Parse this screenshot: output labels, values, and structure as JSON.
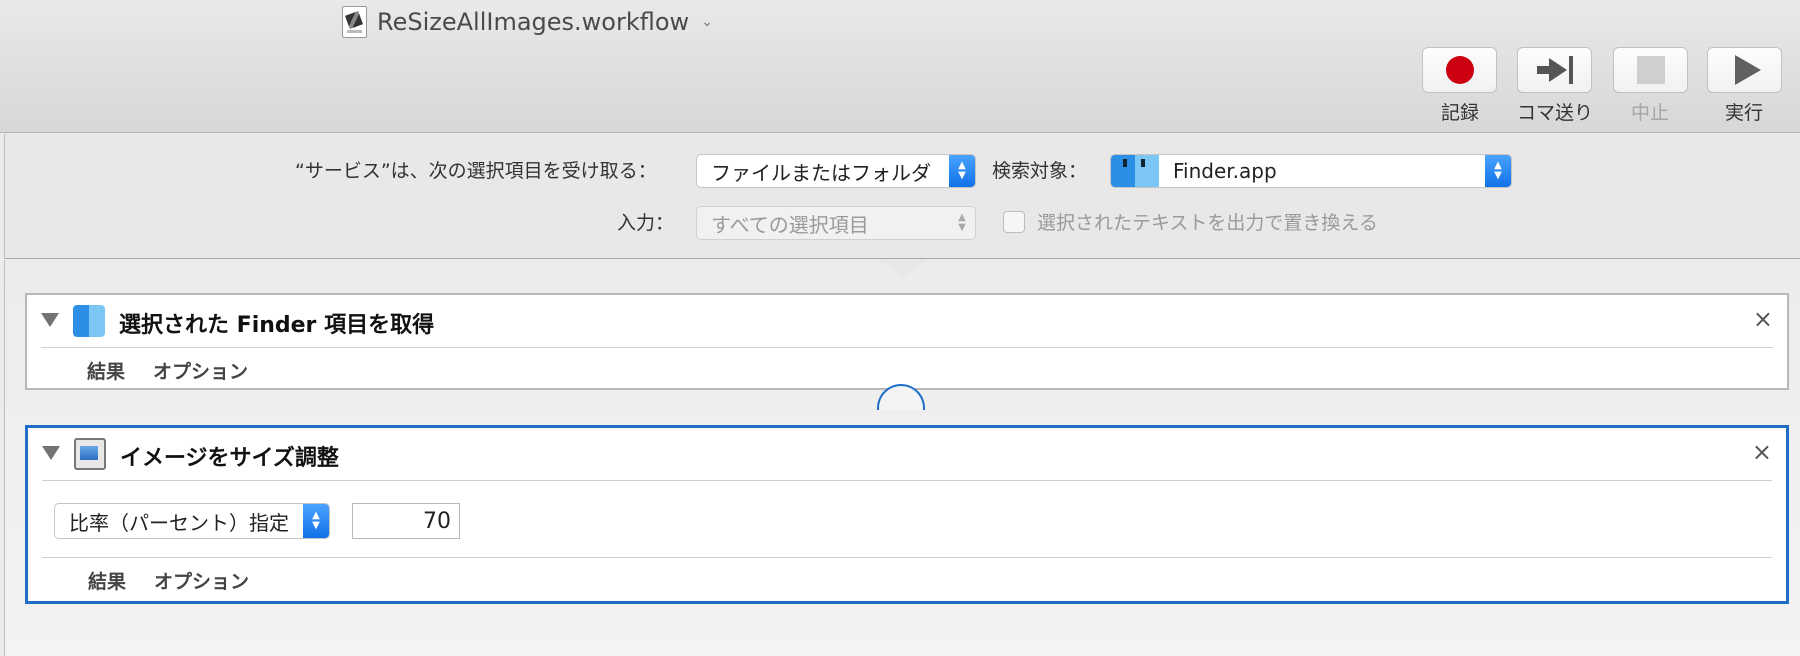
{
  "window": {
    "title": "ReSizeAllImages.workflow"
  },
  "toolbar": {
    "record": "記録",
    "step": "コマ送り",
    "stop": "中止",
    "run": "実行"
  },
  "service": {
    "receives_label": "“サービス”は、次の選択項目を受け取る：",
    "receives_value": "ファイルまたはフォルダ",
    "in_label": "検索対象：",
    "in_value": "Finder.app",
    "input_label": "入力：",
    "input_value": "すべての選択項目",
    "replace_label": "選択されたテキストを出力で置き換える",
    "replace_checked": false
  },
  "actions": [
    {
      "title": "選択された Finder 項目を取得",
      "tabs": [
        "結果",
        "オプション"
      ]
    },
    {
      "title": "イメージをサイズ調整",
      "mode_value": "比率（パーセント）指定",
      "percent_value": "70",
      "tabs": [
        "結果",
        "オプション"
      ]
    }
  ],
  "icons": {
    "close": "×",
    "selected_accent": "#1e6ec6",
    "record_color": "#cc0010"
  }
}
